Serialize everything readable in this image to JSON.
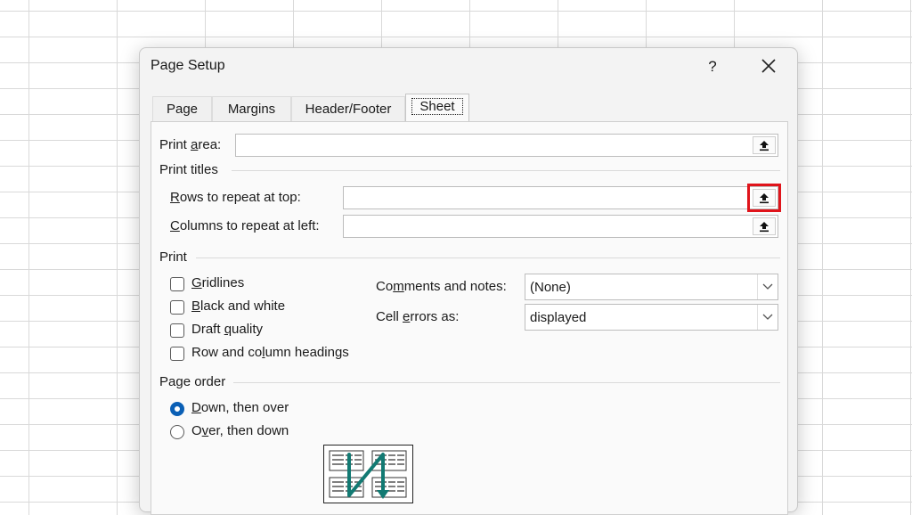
{
  "dialog": {
    "title": "Page Setup",
    "help_label": "?"
  },
  "tabs": [
    {
      "label": "Page"
    },
    {
      "label": "Margins"
    },
    {
      "label": "Header/Footer"
    },
    {
      "label": "Sheet",
      "active": true
    }
  ],
  "print_area": {
    "label_pre": "Print ",
    "label_key": "a",
    "label_post": "rea:",
    "value": ""
  },
  "print_titles": {
    "group_title": "Print titles",
    "rows": {
      "label_key": "R",
      "label_post": "ows to repeat at top:",
      "value": ""
    },
    "columns": {
      "label_key": "C",
      "label_post": "olumns to repeat at left:",
      "value": ""
    }
  },
  "print": {
    "group_title": "Print",
    "checkboxes": [
      {
        "key": "G",
        "rest": "ridlines",
        "checked": false
      },
      {
        "key": "B",
        "rest": "lack and white",
        "checked": false
      },
      {
        "pre": "Draft ",
        "key": "q",
        "rest": "uality",
        "checked": false
      },
      {
        "pre": "Row and co",
        "key": "l",
        "rest": "umn headings",
        "checked": false
      }
    ],
    "comments": {
      "pre": "Co",
      "key": "m",
      "post": "ments and notes:",
      "value": "(None)"
    },
    "cell_errors": {
      "pre": "Cell ",
      "key": "e",
      "post": "rrors as:",
      "value": "displayed"
    }
  },
  "page_order": {
    "group_title": "Page order",
    "options": [
      {
        "key": "D",
        "rest": "own, then over",
        "selected": true
      },
      {
        "pre": "O",
        "key": "v",
        "rest": "er, then down",
        "selected": false
      }
    ]
  },
  "colors": {
    "highlight": "#e0141b",
    "radio_accent": "#0a5fb5",
    "order_arrow": "#127a73"
  },
  "icons": {
    "collapse": "collapse-dialog-icon",
    "close": "close-icon",
    "dropdown": "chevron-down-icon"
  }
}
